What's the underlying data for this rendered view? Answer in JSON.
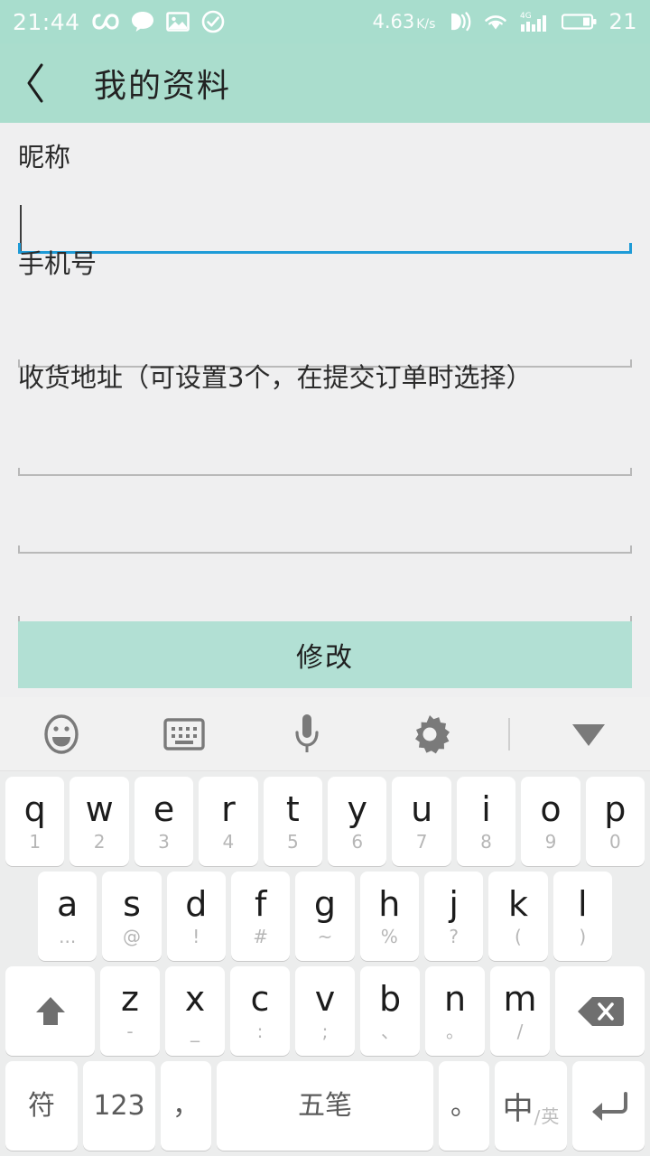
{
  "statusbar": {
    "time": "21:44",
    "icons_left": [
      "infinity-icon",
      "chat-bubble-icon",
      "photo-icon",
      "check-circle-icon"
    ],
    "network_speed": "4.63",
    "network_speed_unit": "K/s",
    "icons_right": [
      "gesture-touch-icon",
      "wifi-icon",
      "signal-4g-icon"
    ],
    "battery_level": "21",
    "bg_color": "#a8ddcd"
  },
  "appbar": {
    "back_icon": "chevron-left-icon",
    "title": "我的资料",
    "bg_color": "#aaddcd"
  },
  "form": {
    "fields": [
      {
        "label": "昵称",
        "value": "",
        "focused": true
      },
      {
        "label": "手机号",
        "value": "",
        "focused": false
      },
      {
        "label": "收货地址（可设置3个，在提交订单时选择）",
        "value": "",
        "focused": false
      },
      {
        "label": "",
        "value": "",
        "focused": false
      },
      {
        "label": "",
        "value": "",
        "focused": false
      }
    ],
    "focus_color": "#1e9bd7",
    "bg_color": "#efeff0"
  },
  "submit": {
    "label": "修改",
    "bg_color": "#b2e0d4"
  },
  "keyboard": {
    "toolbar": [
      {
        "name": "emoji-icon"
      },
      {
        "name": "keyboard-icon"
      },
      {
        "name": "microphone-icon"
      },
      {
        "name": "gear-icon"
      },
      {
        "name": "divider"
      },
      {
        "name": "chevron-down-icon"
      }
    ],
    "row1": [
      {
        "main": "q",
        "sub": "1"
      },
      {
        "main": "w",
        "sub": "2"
      },
      {
        "main": "e",
        "sub": "3"
      },
      {
        "main": "r",
        "sub": "4"
      },
      {
        "main": "t",
        "sub": "5"
      },
      {
        "main": "y",
        "sub": "6"
      },
      {
        "main": "u",
        "sub": "7"
      },
      {
        "main": "i",
        "sub": "8"
      },
      {
        "main": "o",
        "sub": "9"
      },
      {
        "main": "p",
        "sub": "0"
      }
    ],
    "row2": [
      {
        "main": "a",
        "sub": "..."
      },
      {
        "main": "s",
        "sub": "@"
      },
      {
        "main": "d",
        "sub": "!"
      },
      {
        "main": "f",
        "sub": "#"
      },
      {
        "main": "g",
        "sub": "~"
      },
      {
        "main": "h",
        "sub": "%"
      },
      {
        "main": "j",
        "sub": "?"
      },
      {
        "main": "k",
        "sub": "("
      },
      {
        "main": "l",
        "sub": ")"
      }
    ],
    "row3": [
      {
        "main": "",
        "sub": "",
        "icon": "shift-arrow-icon"
      },
      {
        "main": "z",
        "sub": "-"
      },
      {
        "main": "x",
        "sub": "_"
      },
      {
        "main": "c",
        "sub": ":"
      },
      {
        "main": "v",
        "sub": ";"
      },
      {
        "main": "b",
        "sub": "、"
      },
      {
        "main": "n",
        "sub": "。"
      },
      {
        "main": "m",
        "sub": "/"
      },
      {
        "main": "",
        "sub": "",
        "icon": "backspace-icon"
      }
    ],
    "row4": [
      {
        "main": "符",
        "name": "symbols-key"
      },
      {
        "main": "123",
        "name": "numbers-key"
      },
      {
        "main": "，",
        "name": "comma-key"
      },
      {
        "main": "五笔",
        "name": "wubi-space-key"
      },
      {
        "main": "。",
        "name": "period-key"
      },
      {
        "main": "中",
        "sub": "英",
        "name": "language-toggle-key"
      },
      {
        "main": "",
        "name": "enter-key",
        "icon": "enter-icon"
      }
    ],
    "bg_color": "#eceded"
  }
}
